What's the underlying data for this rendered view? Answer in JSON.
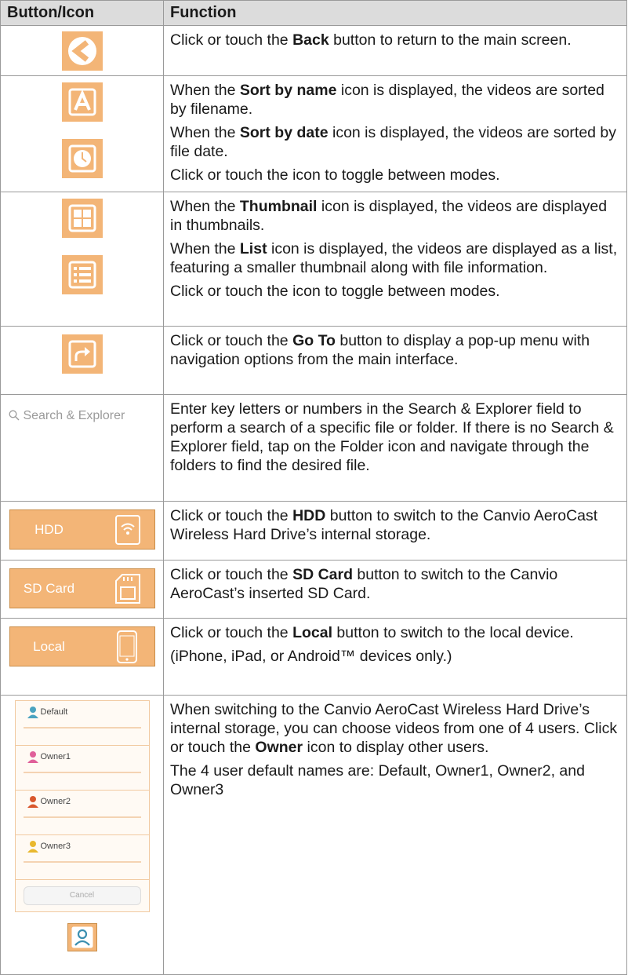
{
  "header": {
    "col1": "Button/Icon",
    "col2": "Function"
  },
  "rows": {
    "back": {
      "a": "Click or touch the ",
      "b": "Back",
      "c": " button to return to the main screen."
    },
    "sort": {
      "p1a": "When the ",
      "p1b": "Sort by name",
      "p1c": " icon is displayed, the videos are sorted by filename.",
      "p2a": "When the ",
      "p2b": "Sort by date",
      "p2c": " icon is displayed, the videos are sorted by file date.",
      "p3": "Click or touch the icon to toggle between modes."
    },
    "view": {
      "p1a": "When the ",
      "p1b": "Thumbnail",
      "p1c": " icon is displayed, the videos are displayed in thumbnails.",
      "p2a": "When the ",
      "p2b": "List",
      "p2c": " icon is displayed, the videos are displayed as a list, featuring a smaller thumbnail along with file information.",
      "p3": "Click or touch the icon to toggle between modes."
    },
    "goto": {
      "a": "Click or touch the ",
      "b": "Go To",
      "c": " button to display a pop-up menu with navigation options from the main interface."
    },
    "search": {
      "icon_label": "Search & Explorer",
      "text": "Enter key letters or numbers in the Search & Explorer field to perform a search of a specific file or folder. If there is no Search & Explorer field, tap on the Folder icon and navigate through the folders to find the desired file."
    },
    "hdd": {
      "btn": "HDD",
      "a": "Click or touch the ",
      "b": "HDD",
      "c": " button to switch to the Canvio AeroCast Wireless Hard Drive’s internal storage."
    },
    "sd": {
      "btn": "SD Card",
      "a": "Click or touch the ",
      "b": "SD Card",
      "c": " button to switch to the Canvio AeroCast’s inserted SD Card."
    },
    "local": {
      "btn": "Local",
      "a": "Click or touch the ",
      "b": "Local",
      "c": " button to switch to the local device.",
      "p2": "(iPhone, iPad, or Android™ devices only.)"
    },
    "owner": {
      "panel": {
        "users": [
          {
            "name": "Default"
          },
          {
            "name": "Owner1"
          },
          {
            "name": "Owner2"
          },
          {
            "name": "Owner3"
          }
        ],
        "cancel": "Cancel"
      },
      "p1a": "When switching to the Canvio AeroCast Wireless Hard Drive’s internal storage, you can choose videos from one of 4 users. Click or touch the ",
      "p1b": "Owner",
      "p1c": " icon to display other users.",
      "p2": "The 4 user default names are: Default, Owner1, Owner2, and Owner3"
    }
  },
  "colors": {
    "accent": "#f3b577",
    "header_bg": "#dcdcdc",
    "border": "#9a9a9a"
  }
}
